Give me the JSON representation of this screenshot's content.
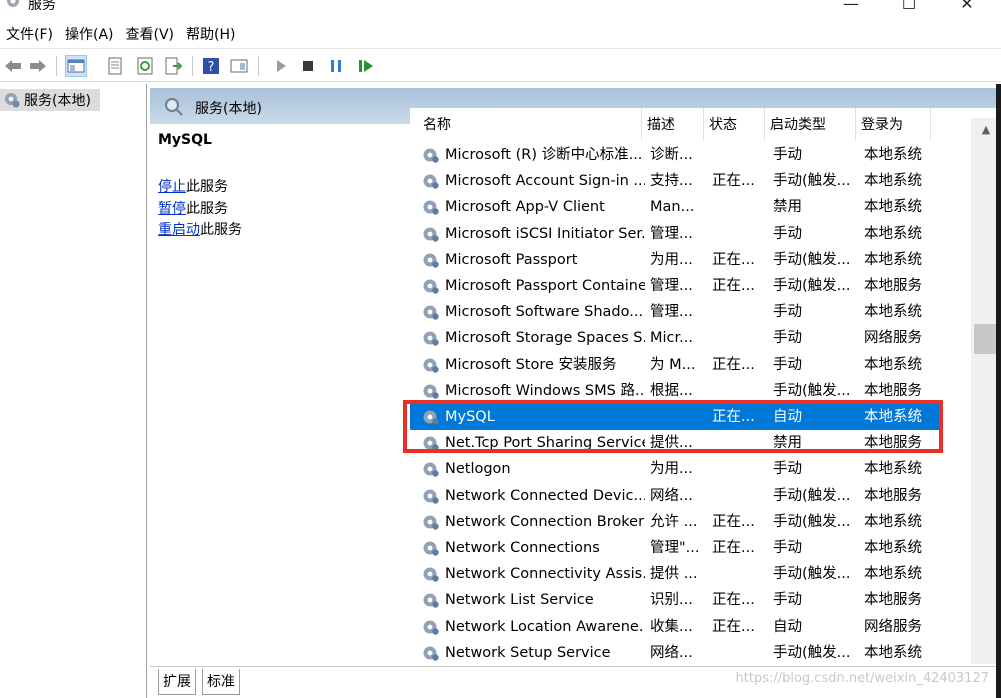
{
  "window": {
    "title": "服务",
    "minimize": "—",
    "maximize": "☐",
    "close": "✕"
  },
  "menu": [
    "文件(F)",
    "操作(A)",
    "查看(V)",
    "帮助(H)"
  ],
  "tree": {
    "root_label": "服务(本地)"
  },
  "panel": {
    "header": "服务(本地)"
  },
  "description": {
    "service_name": "MySQL",
    "actions": [
      {
        "link": "停止",
        "suffix": "此服务"
      },
      {
        "link": "暂停",
        "suffix": "此服务"
      },
      {
        "link": "重启动",
        "suffix": "此服务"
      }
    ]
  },
  "columns": [
    "名称",
    "描述",
    "状态",
    "启动类型",
    "登录为"
  ],
  "rows": [
    {
      "name": "Microsoft (R) 诊断中心标准...",
      "desc": "诊断...",
      "status": "",
      "start": "手动",
      "logon": "本地系统"
    },
    {
      "name": "Microsoft Account Sign-in ...",
      "desc": "支持...",
      "status": "正在...",
      "start": "手动(触发...",
      "logon": "本地系统"
    },
    {
      "name": "Microsoft App-V Client",
      "desc": "Man...",
      "status": "",
      "start": "禁用",
      "logon": "本地系统"
    },
    {
      "name": "Microsoft iSCSI Initiator Ser...",
      "desc": "管理...",
      "status": "",
      "start": "手动",
      "logon": "本地系统"
    },
    {
      "name": "Microsoft Passport",
      "desc": "为用...",
      "status": "正在...",
      "start": "手动(触发...",
      "logon": "本地系统"
    },
    {
      "name": "Microsoft Passport Container",
      "desc": "管理...",
      "status": "正在...",
      "start": "手动(触发...",
      "logon": "本地服务"
    },
    {
      "name": "Microsoft Software Shado...",
      "desc": "管理...",
      "status": "",
      "start": "手动",
      "logon": "本地系统"
    },
    {
      "name": "Microsoft Storage Spaces S...",
      "desc": "Micr...",
      "status": "",
      "start": "手动",
      "logon": "网络服务"
    },
    {
      "name": "Microsoft Store 安装服务",
      "desc": "为 M...",
      "status": "正在...",
      "start": "手动",
      "logon": "本地系统"
    },
    {
      "name": "Microsoft Windows SMS 路...",
      "desc": "根据...",
      "status": "",
      "start": "手动(触发...",
      "logon": "本地服务"
    },
    {
      "name": "MySQL",
      "desc": "",
      "status": "正在...",
      "start": "自动",
      "logon": "本地系统"
    },
    {
      "name": "Net.Tcp Port Sharing Service",
      "desc": "提供...",
      "status": "",
      "start": "禁用",
      "logon": "本地服务"
    },
    {
      "name": "Netlogon",
      "desc": "为用...",
      "status": "",
      "start": "手动",
      "logon": "本地系统"
    },
    {
      "name": "Network Connected Devic...",
      "desc": "网络...",
      "status": "",
      "start": "手动(触发...",
      "logon": "本地服务"
    },
    {
      "name": "Network Connection Broker",
      "desc": "允许 ...",
      "status": "正在...",
      "start": "手动(触发...",
      "logon": "本地系统"
    },
    {
      "name": "Network Connections",
      "desc": "管理\"...",
      "status": "正在...",
      "start": "手动",
      "logon": "本地系统"
    },
    {
      "name": "Network Connectivity Assis...",
      "desc": "提供 ...",
      "status": "",
      "start": "手动(触发...",
      "logon": "本地系统"
    },
    {
      "name": "Network List Service",
      "desc": "识别...",
      "status": "正在...",
      "start": "手动",
      "logon": "本地服务"
    },
    {
      "name": "Network Location Awarene...",
      "desc": "收集...",
      "status": "正在...",
      "start": "自动",
      "logon": "网络服务"
    },
    {
      "name": "Network Setup Service",
      "desc": "网络...",
      "status": "",
      "start": "手动(触发...",
      "logon": "本地系统"
    }
  ],
  "tabs": [
    "扩展",
    "标准"
  ],
  "watermark": "https://blog.csdn.net/weixin_42403127",
  "colors": {
    "selected": "#0078d7",
    "highlight_box": "#e8302b",
    "header_gradient": "#a9c1d9",
    "link": "#0033cc"
  }
}
